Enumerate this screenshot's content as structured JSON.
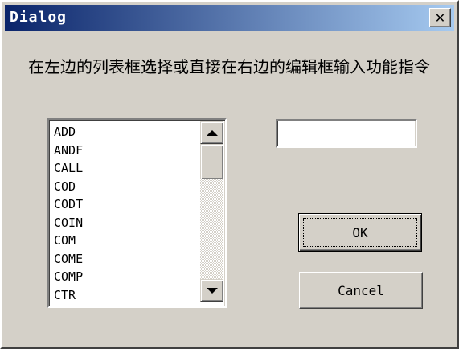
{
  "window": {
    "title": "Dialog",
    "close_symbol": "✕"
  },
  "instruction": "在左边的列表框选择或直接在右边的编辑框输入功能指令",
  "listbox": {
    "items": [
      "ADD",
      "ANDF",
      "CALL",
      "COD",
      "CODT",
      "COIN",
      "COM",
      "COME",
      "COMP",
      "CTR"
    ]
  },
  "edit": {
    "value": ""
  },
  "buttons": {
    "ok": "OK",
    "cancel": "Cancel"
  },
  "colors": {
    "face": "#d4d0c8",
    "title_start": "#0a246a",
    "title_end": "#a6caf0"
  }
}
